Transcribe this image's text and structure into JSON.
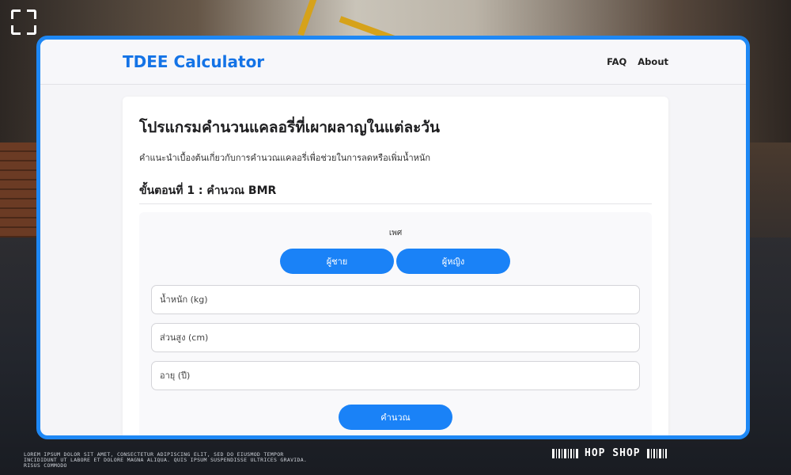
{
  "app": {
    "brand": "TDEE Calculator",
    "nav": [
      {
        "label": "FAQ"
      },
      {
        "label": "About"
      }
    ]
  },
  "main": {
    "title": "โปรแกรมคำนวนแคลอรี่ที่เผาผลาญในแต่ละวัน",
    "subtitle": "คำแนะนำเบื้องต้นเกี่ยวกับการคำนวณแคลอรี่เพื่อช่วยในการลดหรือเพิ่มน้ำหนัก",
    "step_title": "ขั้นตอนที่ 1 : คำนวณ BMR",
    "form": {
      "gender_label": "เพศ",
      "gender_options": [
        {
          "label": "ผู้ชาย"
        },
        {
          "label": "ผู้หญิง"
        }
      ],
      "weight_placeholder": "น้ำหนัก (kg)",
      "height_placeholder": "ส่วนสูง (cm)",
      "age_placeholder": "อายุ (ปี)",
      "submit_label": "คำนวณ"
    }
  },
  "overlay": {
    "lorem_text": "LOREM IPSUM DOLOR SIT AMET, CONSECTETUR ADIPISCING ELIT, SED DO EIUSMOD TEMPOR INCIDIDUNT UT LABORE ET DOLORE MAGNA ALIQUA. QUIS IPSUM SUSPENDISSE ULTRICES GRAVIDA. RISUS COMMODO",
    "shop_text": "HOP SHOP"
  },
  "colors": {
    "accent": "#1a82f7",
    "brand": "#1473e6",
    "frame_border": "#1e88f5"
  }
}
